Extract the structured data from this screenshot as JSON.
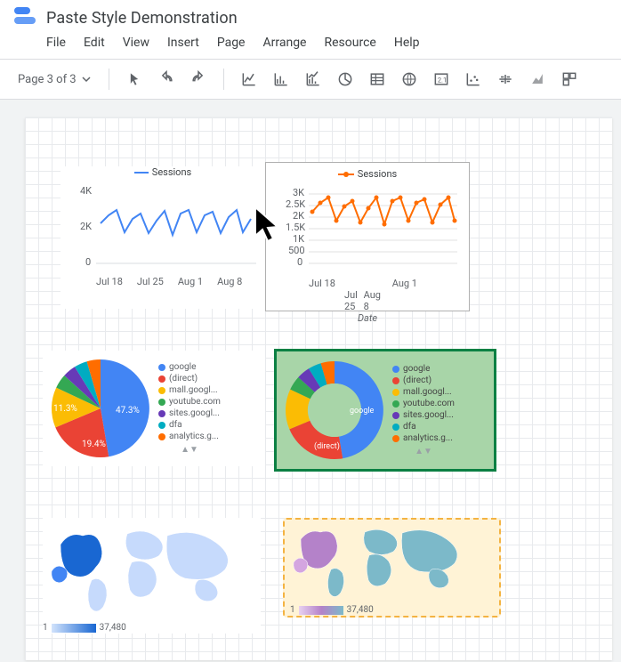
{
  "header": {
    "title": "Paste Style Demonstration",
    "menu": [
      "File",
      "Edit",
      "View",
      "Insert",
      "Page",
      "Arrange",
      "Resource",
      "Help"
    ]
  },
  "toolbar": {
    "page_indicator": "Page 3 of 3"
  },
  "chart_data": [
    {
      "id": "lc1",
      "type": "line",
      "title": "",
      "series": [
        {
          "name": "Sessions",
          "color": "#4285f4"
        }
      ],
      "x": [
        "Jul 18",
        "Jul 25",
        "Aug 1",
        "Aug 8"
      ],
      "values": [
        2300,
        2800,
        3000,
        2100,
        2700,
        2900,
        2050,
        2600,
        2950,
        2000,
        2900,
        3000,
        2100,
        2800,
        2950,
        2050
      ],
      "ylim": [
        0,
        4000
      ],
      "yticks": [
        "0",
        "2K",
        "4K"
      ]
    },
    {
      "id": "lc2",
      "type": "line",
      "title": "",
      "xlabel": "Date",
      "series": [
        {
          "name": "Sessions",
          "color": "#ff6d00"
        }
      ],
      "x": [
        "Jul 18",
        "Jul 25",
        "Aug 1",
        "Aug 8"
      ],
      "values": [
        2300,
        2800,
        3000,
        2100,
        2700,
        2900,
        2050,
        2600,
        2950,
        2000,
        2900,
        3000,
        2100,
        2800,
        2950,
        2050
      ],
      "ylim": [
        0,
        3000
      ],
      "yticks": [
        "0",
        "500",
        "1K",
        "1.5K",
        "2K",
        "2.5K",
        "3K"
      ]
    },
    {
      "id": "pie1",
      "type": "pie",
      "slices": [
        {
          "label": "google",
          "value": 47.3,
          "color": "#4285f4",
          "show_label": "47.3%"
        },
        {
          "label": "(direct)",
          "value": 19.4,
          "color": "#ea4335",
          "show_label": "19.4%"
        },
        {
          "label": "mall.googl...",
          "value": 11.3,
          "color": "#fbbc04",
          "show_label": "11.3%"
        },
        {
          "label": "youtube.com",
          "value": 4,
          "color": "#34a853"
        },
        {
          "label": "sites.googl...",
          "value": 4,
          "color": "#673ab7"
        },
        {
          "label": "dfa",
          "value": 3,
          "color": "#00acc1"
        },
        {
          "label": "analytics.g...",
          "value": 3,
          "color": "#ff6d00"
        }
      ]
    },
    {
      "id": "pie2",
      "type": "pie",
      "donut": true,
      "slices": [
        {
          "label": "google",
          "value": 47.3,
          "color": "#4285f4",
          "show_label": "google"
        },
        {
          "label": "(direct)",
          "value": 19.4,
          "color": "#ea4335",
          "show_label": "(direct)"
        },
        {
          "label": "mall.googl...",
          "value": 11.3,
          "color": "#fbbc04"
        },
        {
          "label": "youtube.com",
          "value": 4,
          "color": "#34a853"
        },
        {
          "label": "sites.googl...",
          "value": 4,
          "color": "#673ab7"
        },
        {
          "label": "dfa",
          "value": 3,
          "color": "#00acc1"
        },
        {
          "label": "analytics.g...",
          "value": 3,
          "color": "#ff6d00"
        }
      ]
    },
    {
      "id": "map1",
      "type": "choropleth",
      "range": {
        "min": "1",
        "max": "37,480"
      },
      "palette": [
        "#d2e3fc",
        "#1967d2"
      ]
    },
    {
      "id": "map2",
      "type": "choropleth",
      "range": {
        "min": "1",
        "max": "37,480"
      },
      "palette": [
        "#e8d1f0",
        "#7cb9c9"
      ]
    }
  ]
}
